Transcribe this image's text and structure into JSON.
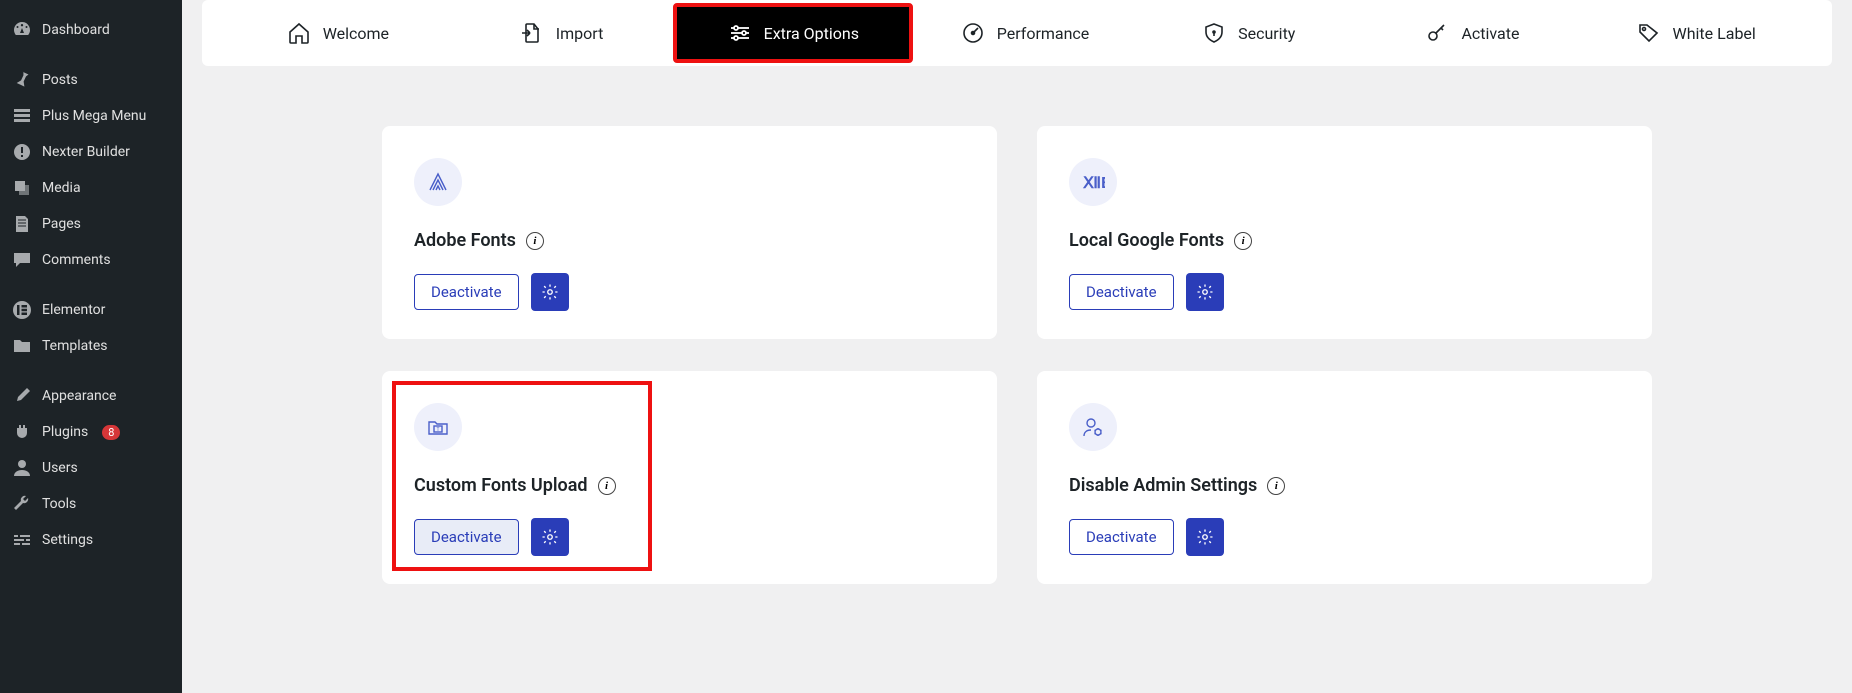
{
  "sidebar": {
    "items": [
      {
        "label": "Dashboard",
        "icon": "speedometer"
      },
      {
        "label": "Posts",
        "icon": "pin"
      },
      {
        "label": "Plus Mega Menu",
        "icon": "grid"
      },
      {
        "label": "Nexter Builder",
        "icon": "alert"
      },
      {
        "label": "Media",
        "icon": "media"
      },
      {
        "label": "Pages",
        "icon": "page"
      },
      {
        "label": "Comments",
        "icon": "comment"
      },
      {
        "label": "Elementor",
        "icon": "elementor"
      },
      {
        "label": "Templates",
        "icon": "folder"
      },
      {
        "label": "Appearance",
        "icon": "brush"
      },
      {
        "label": "Plugins",
        "icon": "plug",
        "badge": "8"
      },
      {
        "label": "Users",
        "icon": "user"
      },
      {
        "label": "Tools",
        "icon": "wrench"
      },
      {
        "label": "Settings",
        "icon": "sliders"
      }
    ]
  },
  "tabs": [
    {
      "label": "Welcome",
      "icon": "home"
    },
    {
      "label": "Import",
      "icon": "import"
    },
    {
      "label": "Extra Options",
      "icon": "options",
      "active": true
    },
    {
      "label": "Performance",
      "icon": "gauge"
    },
    {
      "label": "Security",
      "icon": "shield"
    },
    {
      "label": "Activate",
      "icon": "key"
    },
    {
      "label": "White Label",
      "icon": "tag"
    }
  ],
  "cards": [
    {
      "title": "Adobe Fonts",
      "button": "Deactivate"
    },
    {
      "title": "Local Google Fonts",
      "button": "Deactivate"
    },
    {
      "title": "Custom Fonts Upload",
      "button": "Deactivate",
      "highlight": true
    },
    {
      "title": "Disable Admin Settings",
      "button": "Deactivate"
    }
  ]
}
